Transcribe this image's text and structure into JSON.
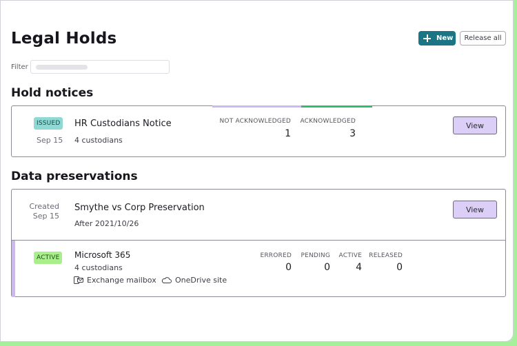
{
  "header": {
    "title": "Legal Holds",
    "new_label": "New",
    "release_all_label": "Release all"
  },
  "filter": {
    "label": "Filter",
    "placeholder": ""
  },
  "hold_notices": {
    "section_title": "Hold notices",
    "item": {
      "status": "ISSUED",
      "date": "Sep 15",
      "title": "HR Custodians Notice",
      "custodians": "4 custodians",
      "stats": [
        {
          "label": "NOT ACKNOWLEDGED",
          "value": "1"
        },
        {
          "label": "ACKNOWLEDGED",
          "value": "3"
        }
      ],
      "progress": {
        "not_acknowledged": 1,
        "acknowledged": 3,
        "not_ack_color": "#cdb8f1",
        "ack_color": "#2fbf6b"
      },
      "view_label": "View"
    }
  },
  "data_preservations": {
    "section_title": "Data preservations",
    "item": {
      "created_label": "Created",
      "date": "Sep 15",
      "title": "Smythe vs Corp Preservation",
      "after": "After 2021/10/26",
      "view_label": "View",
      "source": {
        "status": "ACTIVE",
        "title": "Microsoft 365",
        "custodians": "4 custodians",
        "services": [
          {
            "icon": "exchange-icon",
            "label": "Exchange mailbox"
          },
          {
            "icon": "onedrive-icon",
            "label": "OneDrive site"
          }
        ],
        "stats": [
          {
            "label": "ERRORED",
            "value": "0"
          },
          {
            "label": "PENDING",
            "value": "0"
          },
          {
            "label": "ACTIVE",
            "value": "4"
          },
          {
            "label": "RELEASED",
            "value": "0"
          }
        ]
      }
    }
  },
  "colors": {
    "primary": "#1b7585",
    "view_button": "#dccff7",
    "accent": "#cdb8f1"
  }
}
